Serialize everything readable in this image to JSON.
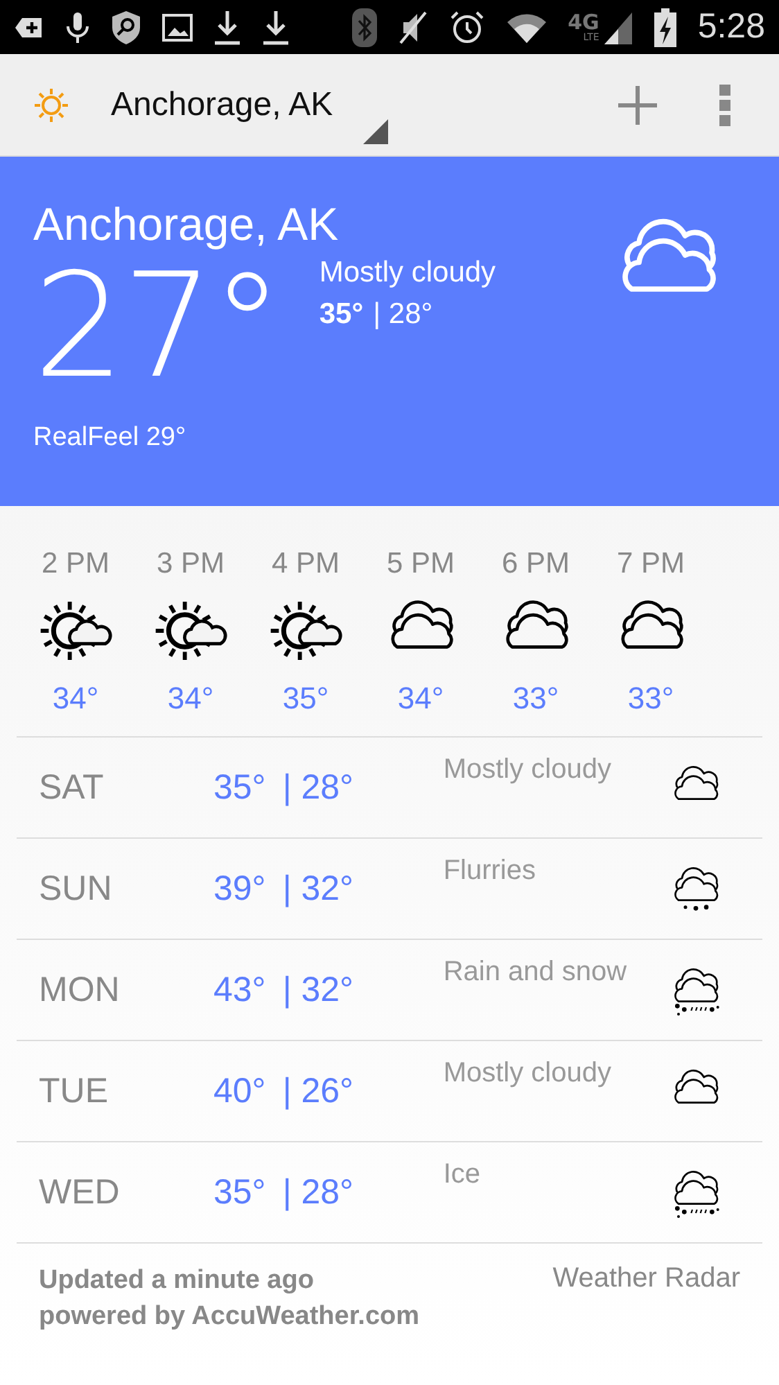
{
  "status_bar": {
    "network": "4G",
    "network_sub": "LTE",
    "time": "5:28"
  },
  "app_bar": {
    "location": "Anchorage, AK"
  },
  "current": {
    "city": "Anchorage, AK",
    "temperature": "27°",
    "condition": "Mostly cloudy",
    "high": "35°",
    "low": "| 28°",
    "realfeel": "RealFeel 29°",
    "kind": "cloudy"
  },
  "hourly": [
    {
      "time": "2 PM",
      "temp": "34°",
      "kind": "partly-sunny"
    },
    {
      "time": "3 PM",
      "temp": "34°",
      "kind": "partly-sunny"
    },
    {
      "time": "4 PM",
      "temp": "35°",
      "kind": "partly-sunny"
    },
    {
      "time": "5 PM",
      "temp": "34°",
      "kind": "cloudy"
    },
    {
      "time": "6 PM",
      "temp": "33°",
      "kind": "cloudy"
    },
    {
      "time": "7 PM",
      "temp": "33°",
      "kind": "cloudy"
    }
  ],
  "daily": [
    {
      "day": "SAT",
      "high": "35°",
      "low": "| 28°",
      "condition": "Mostly cloudy",
      "kind": "cloudy"
    },
    {
      "day": "SUN",
      "high": "39°",
      "low": "| 32°",
      "condition": "Flurries",
      "kind": "flurries"
    },
    {
      "day": "MON",
      "high": "43°",
      "low": "| 32°",
      "condition": "Rain and snow",
      "kind": "rain-snow"
    },
    {
      "day": "TUE",
      "high": "40°",
      "low": "| 26°",
      "condition": "Mostly cloudy",
      "kind": "cloudy"
    },
    {
      "day": "WED",
      "high": "35°",
      "low": "| 28°",
      "condition": "Ice",
      "kind": "rain-snow"
    }
  ],
  "footer": {
    "updated": "Updated a minute ago",
    "powered": "powered by AccuWeather.com",
    "link": "Weather Radar"
  }
}
